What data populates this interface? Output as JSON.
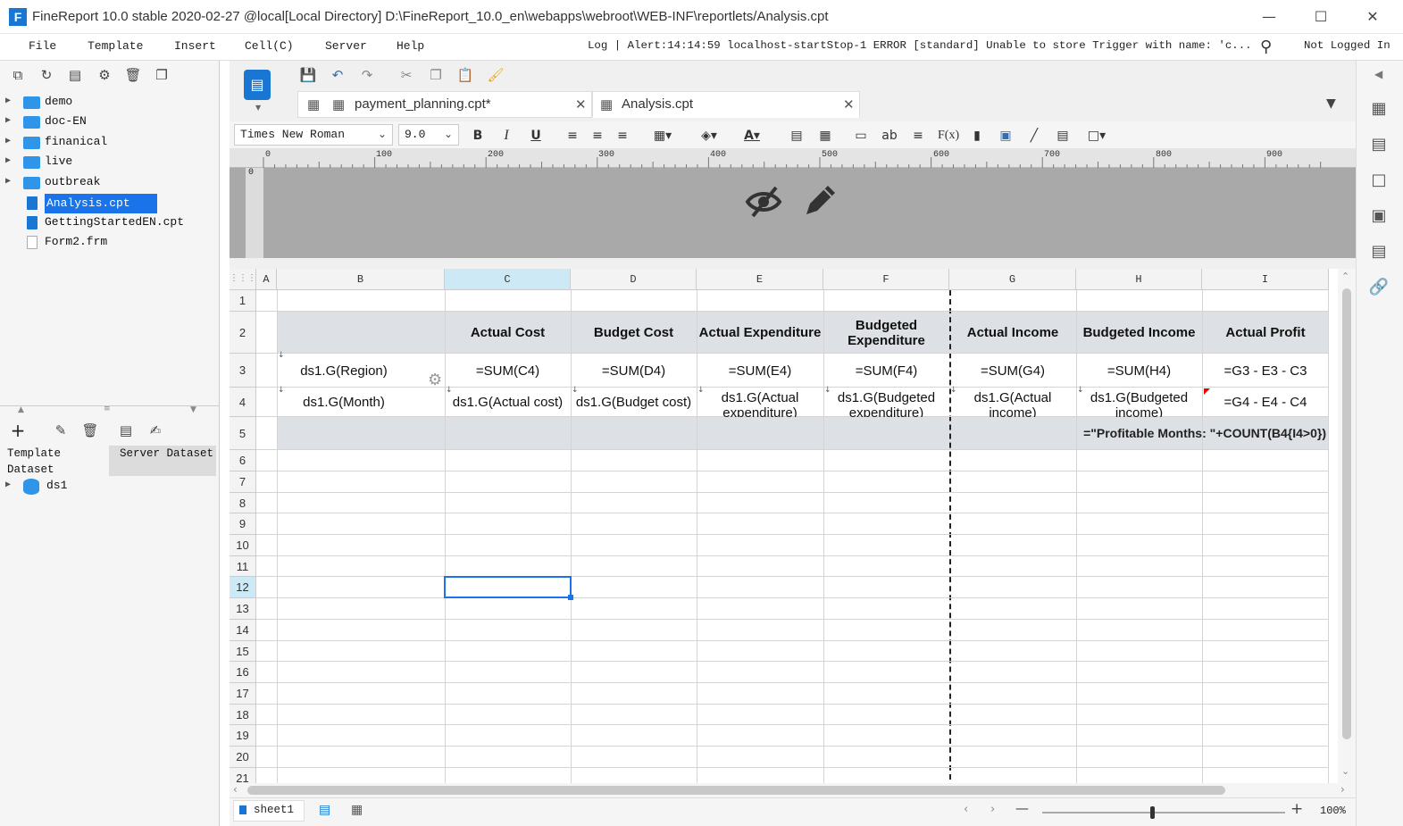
{
  "window": {
    "title": "FineReport 10.0 stable 2020-02-27 @local[Local Directory]    D:\\FineReport_10.0_en\\webapps\\webroot\\WEB-INF\\reportlets/Analysis.cpt",
    "logo": "F",
    "minimize": "—",
    "maximize": "☐",
    "close": "✕"
  },
  "menu": {
    "items": [
      "File",
      "Template",
      "Insert",
      "Cell(C)",
      "Server",
      "Help"
    ],
    "log": "Log | Alert:14:14:59 localhost-startStop-1 ERROR [standard] Unable to store Trigger with name: 'c...",
    "login": "Not Logged In"
  },
  "tree": [
    {
      "label": "demo",
      "type": "folder"
    },
    {
      "label": "doc-EN",
      "type": "folder"
    },
    {
      "label": "finanical",
      "type": "folder"
    },
    {
      "label": "live",
      "type": "folder"
    },
    {
      "label": "outbreak",
      "type": "folder"
    },
    {
      "label": "Analysis.cpt",
      "type": "cpt",
      "selected": true
    },
    {
      "label": "GettingStartedEN.cpt",
      "type": "cpt"
    },
    {
      "label": "Form2.frm",
      "type": "frm"
    }
  ],
  "dataset": {
    "tab_template": "Template Dataset",
    "tab_server": "Server Dataset",
    "items": [
      "ds1"
    ]
  },
  "tabs": [
    {
      "label": "payment_planning.cpt*"
    },
    {
      "label": "Analysis.cpt"
    }
  ],
  "format": {
    "font": "Times New Roman",
    "size": "9.0"
  },
  "ruler": [
    "0",
    "100",
    "200",
    "300",
    "400",
    "500",
    "600",
    "700",
    "800",
    "900"
  ],
  "columns": [
    "A",
    "B",
    "C",
    "D",
    "E",
    "F",
    "G",
    "H",
    "I"
  ],
  "rows": [
    "1",
    "2",
    "3",
    "4",
    "5",
    "6",
    "7",
    "8",
    "9",
    "10",
    "11",
    "12",
    "13",
    "14",
    "15",
    "16",
    "17",
    "18",
    "19",
    "20",
    "21"
  ],
  "cells": {
    "C2": "Actual Cost",
    "D2": "Budget Cost",
    "E2": "Actual Expenditure",
    "F2": "Budgeted Expenditure",
    "G2": "Actual Income",
    "H2": "Budgeted Income",
    "I2": "Actual Profit",
    "B3": "ds1.G(Region)",
    "C3": "=SUM(C4)",
    "D3": "=SUM(D4)",
    "E3": "=SUM(E4)",
    "F3": "=SUM(F4)",
    "G3": "=SUM(G4)",
    "H3": "=SUM(H4)",
    "I3": "=G3 - E3 - C3",
    "B4": "ds1.G(Month)",
    "C4": "ds1.G(Actual cost)",
    "D4": "ds1.G(Budget cost)",
    "E4": "ds1.G(Actual expenditure)",
    "F4": "ds1.G(Budgeted expenditure)",
    "G4": "ds1.G(Actual income)",
    "H4": "ds1.G(Budgeted income)",
    "I4": "=G4 - E4 - C4",
    "H5": "=\"Profitable Months: \"+COUNT(B4{I4>0})"
  },
  "selected_cell": "C12",
  "sheet": {
    "name": "sheet1"
  },
  "zoom": "100%",
  "colors": {
    "accent": "#1976d2",
    "header_fill": "#dde0e4",
    "selection": "#1a73e8"
  }
}
